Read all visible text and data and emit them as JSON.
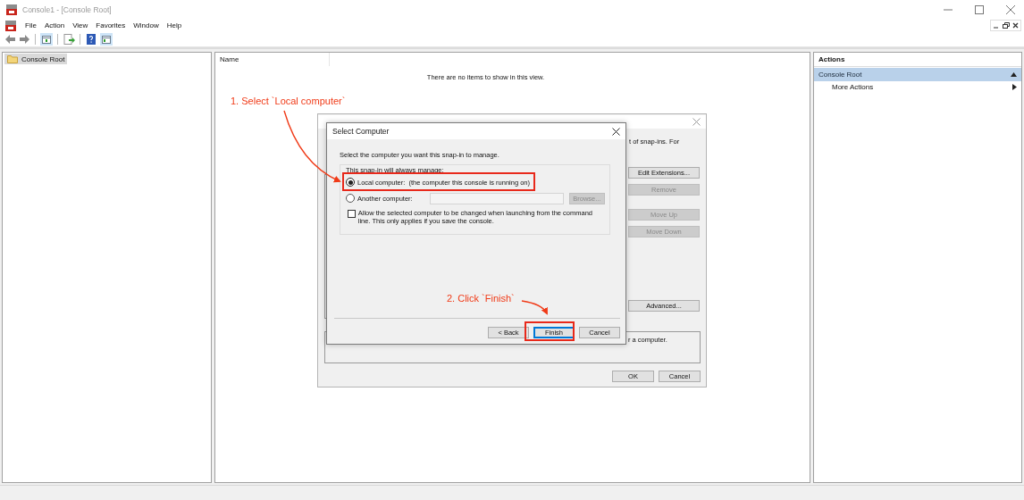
{
  "window": {
    "title": "Console1 - [Console Root]"
  },
  "menu": [
    "File",
    "Action",
    "View",
    "Favorites",
    "Window",
    "Help"
  ],
  "tree": {
    "items": [
      {
        "label": "Console Root",
        "selected": true
      }
    ]
  },
  "list_view": {
    "columns": [
      "Name"
    ],
    "empty_message": "There are no items to show in this view."
  },
  "actions_pane": {
    "title": "Actions",
    "sections": [
      {
        "label": "Console Root",
        "expanded": true,
        "items": [
          "More Actions"
        ]
      }
    ]
  },
  "back_dialog": {
    "right_fragment": "t of snap-ins. For",
    "description_fragment": "r a computer.",
    "side_buttons": [
      {
        "label": "Edit Extensions...",
        "disabled": false
      },
      {
        "label": "Remove",
        "disabled": true
      },
      {
        "label": "Move Up",
        "disabled": true
      },
      {
        "label": "Move Down",
        "disabled": true
      },
      {
        "label": "Advanced...",
        "disabled": false
      }
    ],
    "buttons": [
      "OK",
      "Cancel"
    ]
  },
  "dialog": {
    "title": "Select Computer",
    "instruction": "Select the computer you want this snap-in to manage.",
    "group_label": "This snap-in will always manage:",
    "options": [
      {
        "label": "Local computer:  (the computer this console is running on)",
        "selected": true
      },
      {
        "label": "Another computer:",
        "selected": false
      }
    ],
    "computer_field": {
      "disabled": true
    },
    "browse_button": {
      "label": "Browse...",
      "disabled": true
    },
    "checkbox": {
      "label": "Allow the selected computer to be changed when launching from the command line.  This only applies if you save the console.",
      "checked": false
    },
    "buttons": [
      {
        "label": "< Back",
        "default": false
      },
      {
        "label": "Finish",
        "default": true
      },
      {
        "label": "Cancel",
        "default": false
      }
    ]
  },
  "annotations": [
    "1. Select `Local computer`",
    "2. Click `Finish`"
  ]
}
